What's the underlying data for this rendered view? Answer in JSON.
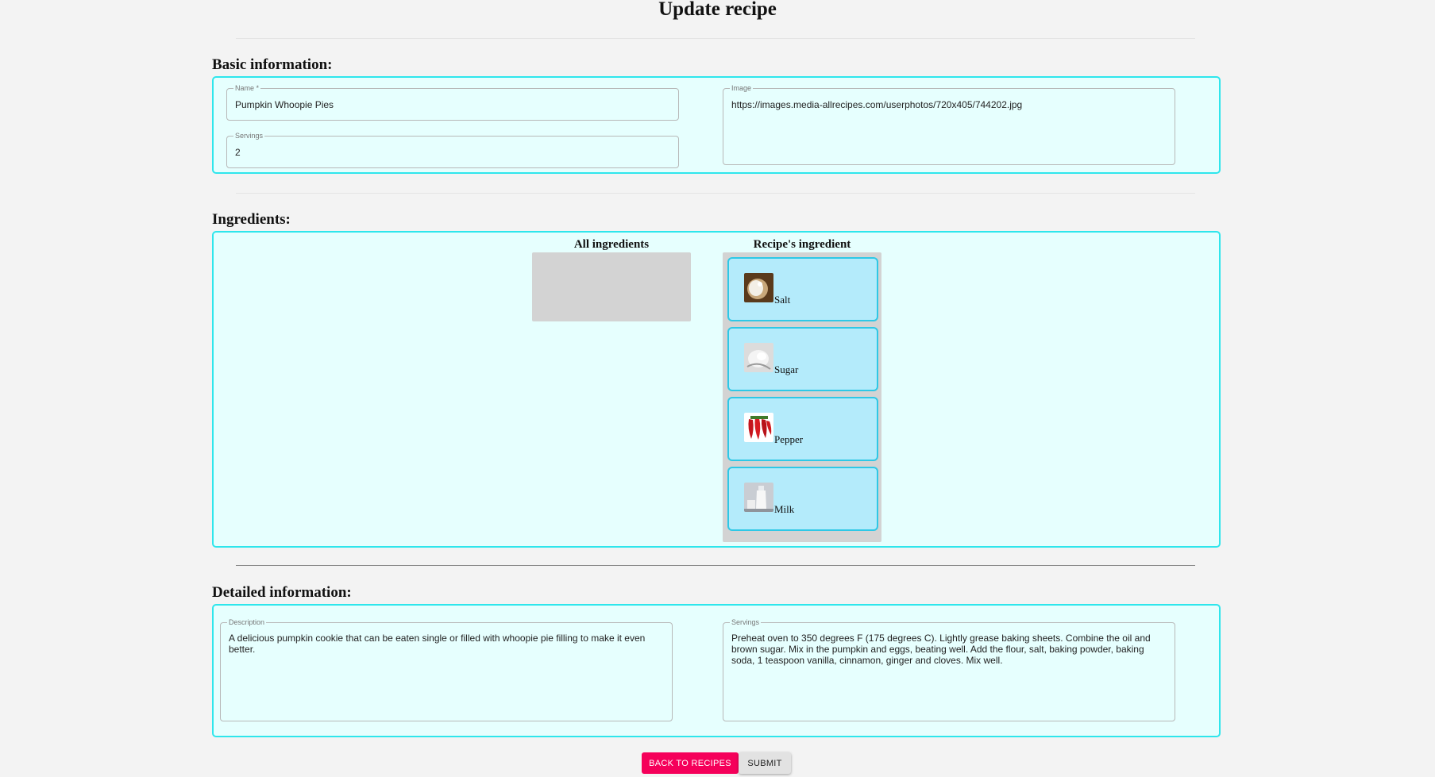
{
  "page": {
    "title": "Update recipe"
  },
  "basic": {
    "heading": "Basic information:",
    "name": {
      "label": "Name *",
      "value": "Pumpkin Whoopie Pies"
    },
    "servings": {
      "label": "Servings",
      "value": "2"
    },
    "image": {
      "label": "Image",
      "value": "https://images.media-allrecipes.com/userphotos/720x405/744202.jpg"
    }
  },
  "ingredients": {
    "heading": "Ingredients:",
    "all_title": "All ingredients",
    "recipe_title": "Recipe's ingredient",
    "items": [
      {
        "name": "Salt",
        "icon": "salt-icon"
      },
      {
        "name": "Sugar",
        "icon": "sugar-icon"
      },
      {
        "name": "Pepper",
        "icon": "pepper-icon"
      },
      {
        "name": "Milk",
        "icon": "milk-icon"
      }
    ]
  },
  "detailed": {
    "heading": "Detailed information:",
    "description": {
      "label": "Description",
      "value": "A delicious pumpkin cookie that can be eaten single or filled with whoopie pie filling to make it even better."
    },
    "steps": {
      "label": "Servings",
      "value": "Preheat oven to 350 degrees F (175 degrees C). Lightly grease baking sheets. Combine the oil and brown sugar. Mix in the pumpkin and eggs, beating well. Add the flour, salt, baking powder, baking soda, 1 teaspoon vanilla, cinnamon, ginger and cloves. Mix well."
    }
  },
  "actions": {
    "back_label": "Back to recipes",
    "submit_label": "Submit"
  },
  "colors": {
    "panel_border": "#2ee6ec",
    "panel_bg": "#e6fffe",
    "card_bg": "#b4ebfb",
    "primary": "#f5005a"
  }
}
